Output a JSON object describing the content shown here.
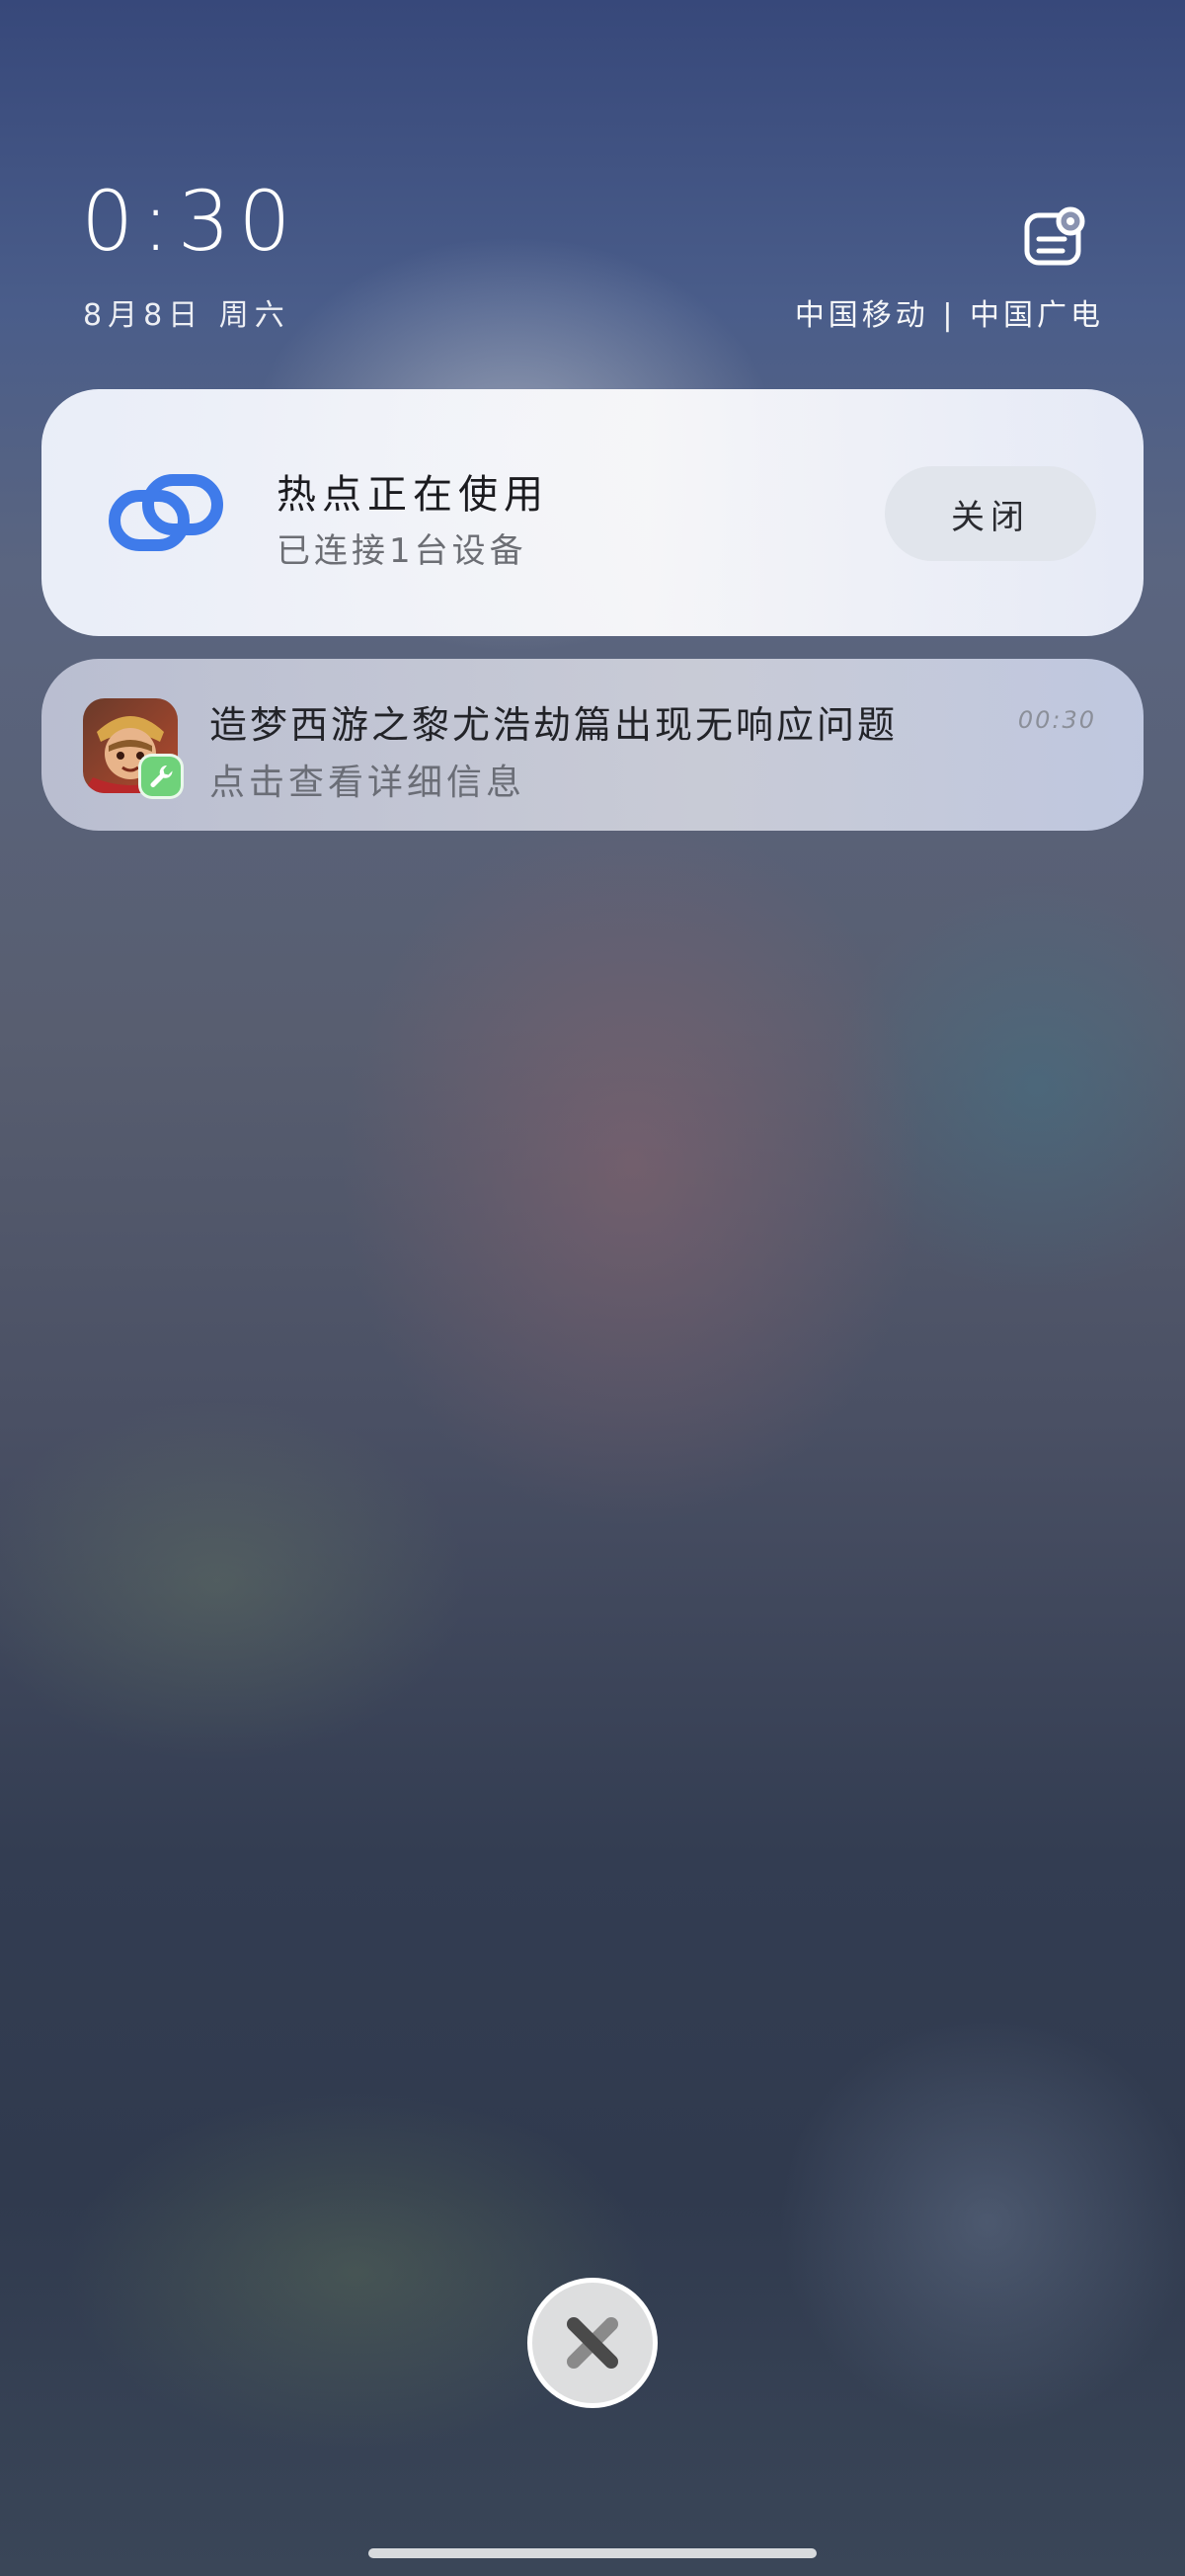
{
  "lockscreen": {
    "time": "0:30",
    "date": "8月8日 周六",
    "carrier": "中国移动 | 中国广电",
    "edit_icon": "edit-lockscreen-icon"
  },
  "hotspot_card": {
    "icon": "link-icon",
    "title": "热点正在使用",
    "subtitle": "已连接1台设备",
    "close_label": "关闭",
    "accent_color": "#3f7bea"
  },
  "notification": {
    "app_icon": "game-app-icon",
    "badge_icon": "wrench-icon",
    "title": "造梦西游之黎尤浩劫篇出现无响应问题",
    "subtitle": "点击查看详细信息",
    "time": "00:30",
    "badge_color": "#6fd27a"
  },
  "bottom": {
    "clear_icon": "clear-all-icon"
  }
}
